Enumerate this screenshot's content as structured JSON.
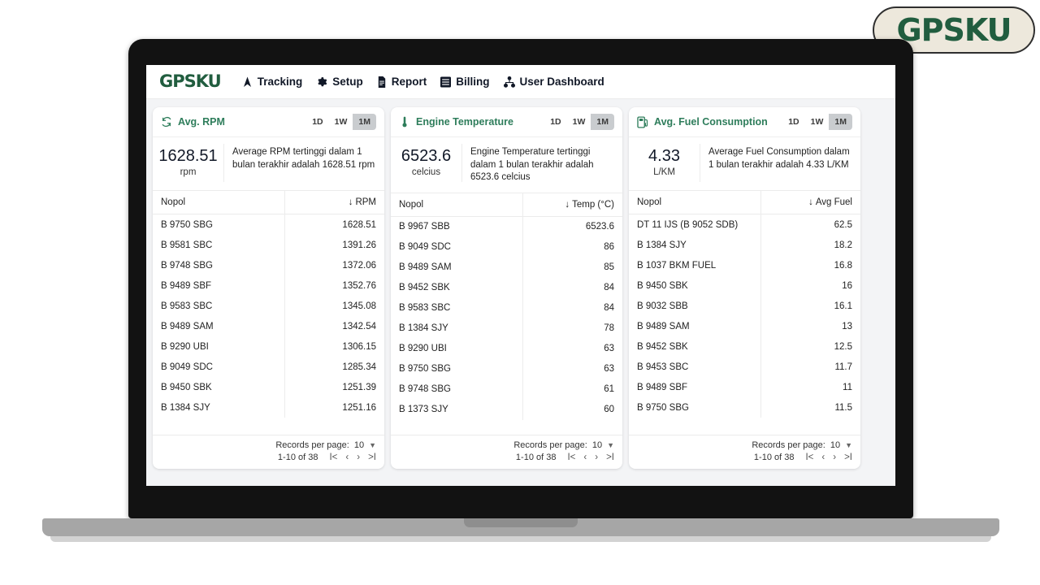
{
  "brand": {
    "logo_text": "GPSKU",
    "badge_logo_text": "GPSKU"
  },
  "topnav": {
    "items": [
      {
        "label": "Tracking",
        "icon": "navigation-arrow-icon"
      },
      {
        "label": "Setup",
        "icon": "gear-icon"
      },
      {
        "label": "Report",
        "icon": "document-icon"
      },
      {
        "label": "Billing",
        "icon": "invoice-icon"
      },
      {
        "label": "User Dashboard",
        "icon": "org-chart-icon"
      }
    ]
  },
  "range_options": [
    "1D",
    "1W",
    "1M"
  ],
  "selected_range": "1M",
  "pagination": {
    "records_per_page_label": "Records per page:",
    "records_per_page_value": "10",
    "range_text": "1-10 of 38",
    "first_label": "I<",
    "prev_label": "‹",
    "next_label": "›",
    "last_label": ">I"
  },
  "cards": [
    {
      "title": "Avg. RPM",
      "icon": "rotation-refresh-icon",
      "big_value": "1628.51",
      "unit": "rpm",
      "description": "Average RPM tertinggi dalam 1 bulan terakhir adalah 1628.51 rpm",
      "columns": [
        "Nopol",
        "RPM"
      ],
      "rows": [
        {
          "nopol": "B 9750 SBG",
          "value": "1628.51"
        },
        {
          "nopol": "B 9581 SBC",
          "value": "1391.26"
        },
        {
          "nopol": "B 9748 SBG",
          "value": "1372.06"
        },
        {
          "nopol": "B 9489 SBF",
          "value": "1352.76"
        },
        {
          "nopol": "B 9583 SBC",
          "value": "1345.08"
        },
        {
          "nopol": "B 9489 SAM",
          "value": "1342.54"
        },
        {
          "nopol": "B 9290 UBI",
          "value": "1306.15"
        },
        {
          "nopol": "B 9049 SDC",
          "value": "1285.34"
        },
        {
          "nopol": "B 9450 SBK",
          "value": "1251.39"
        },
        {
          "nopol": "B 1384 SJY",
          "value": "1251.16"
        }
      ]
    },
    {
      "title": "Engine Temperature",
      "icon": "thermometer-icon",
      "big_value": "6523.6",
      "unit": "celcius",
      "description": "Engine Temperature tertinggi dalam 1 bulan terakhir adalah 6523.6 celcius",
      "columns": [
        "Nopol",
        "Temp (°C)"
      ],
      "rows": [
        {
          "nopol": "B 9967 SBB",
          "value": "6523.6"
        },
        {
          "nopol": "B 9049 SDC",
          "value": "86"
        },
        {
          "nopol": "B 9489 SAM",
          "value": "85"
        },
        {
          "nopol": "B 9452 SBK",
          "value": "84"
        },
        {
          "nopol": "B 9583 SBC",
          "value": "84"
        },
        {
          "nopol": "B 1384 SJY",
          "value": "78"
        },
        {
          "nopol": "B 9290 UBI",
          "value": "63"
        },
        {
          "nopol": "B 9750 SBG",
          "value": "63"
        },
        {
          "nopol": "B 9748 SBG",
          "value": "61"
        },
        {
          "nopol": "B 1373 SJY",
          "value": "60"
        }
      ]
    },
    {
      "title": "Avg. Fuel Consumption",
      "icon": "fuel-pump-icon",
      "big_value": "4.33",
      "unit": "L/KM",
      "description": "Average Fuel Consumption dalam 1 bulan terakhir adalah 4.33 L/KM",
      "columns": [
        "Nopol",
        "Avg Fuel"
      ],
      "rows": [
        {
          "nopol": "DT 11 IJS (B 9052 SDB)",
          "value": "62.5"
        },
        {
          "nopol": "B 1384 SJY",
          "value": "18.2"
        },
        {
          "nopol": "B 1037 BKM FUEL",
          "value": "16.8"
        },
        {
          "nopol": "B 9450 SBK",
          "value": "16"
        },
        {
          "nopol": "B 9032 SBB",
          "value": "16.1"
        },
        {
          "nopol": "B 9489 SAM",
          "value": "13"
        },
        {
          "nopol": "B 9452 SBK",
          "value": "12.5"
        },
        {
          "nopol": "B 9453 SBC",
          "value": "11.7"
        },
        {
          "nopol": "B 9489 SBF",
          "value": "11"
        },
        {
          "nopol": "B 9750 SBG",
          "value": "11.5"
        }
      ]
    }
  ],
  "colors": {
    "brand_green": "#215d3f",
    "card_title_green": "#2e7d5b",
    "badge_bg": "#ede8dc",
    "screen_bg": "#f3f4f6"
  }
}
